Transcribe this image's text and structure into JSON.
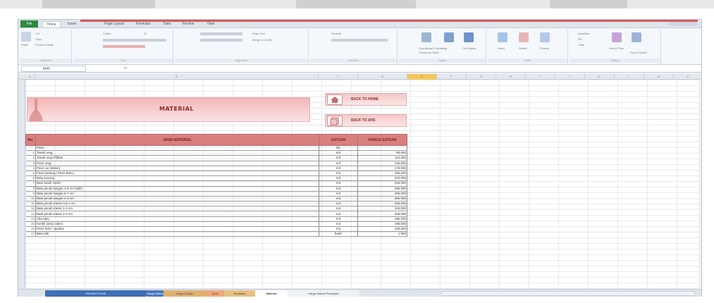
{
  "ribbon": {
    "file_tab": "File",
    "tabs": [
      "Home",
      "Insert",
      "Page Layout",
      "Formulas",
      "Data",
      "Review",
      "View"
    ],
    "clipboard": {
      "paste": "Paste",
      "cut": "Cut",
      "copy": "Copy",
      "format_painter": "Format Painter",
      "group": "Clipboard"
    },
    "font": {
      "name": "Calibri",
      "size": "11",
      "group": "Font"
    },
    "alignment": {
      "wrap": "Wrap Text",
      "merge": "Merge & Center",
      "group": "Alignment"
    },
    "number": {
      "format": "General",
      "group": "Number"
    },
    "styles": {
      "conditional": "Conditional Formatting",
      "format_table": "Format as Table",
      "cell_styles": "Cell Styles",
      "group": "Styles"
    },
    "cells": {
      "insert": "Insert",
      "delete": "Delete",
      "format": "Format",
      "group": "Cells"
    },
    "editing": {
      "autosum": "AutoSum",
      "fill": "Fill",
      "clear": "Clear",
      "sort": "Sort & Filter",
      "find": "Find & Select",
      "group": "Editing"
    }
  },
  "formula_bar": {
    "name_box": "M40",
    "fx": "fx"
  },
  "colors": {
    "accent_red": "#d35e5e",
    "header_fill": "#d88080",
    "banner_fill": "#f3b6b6",
    "selected_col": "#f3c65b"
  },
  "material": {
    "title": "MATERIAL"
  },
  "nav": {
    "back_home": "BACK TO HOME",
    "back_ahs": "BACK TO AHS",
    "home_icon": "home-icon",
    "ahs_icon": "document-icon"
  },
  "table": {
    "headers": {
      "no": "No.",
      "jenis": "JENIS MATERIAL",
      "satuan": "SATUAN",
      "harga": "HARGA SATUAN"
    },
    "rows": [
      {
        "no": "",
        "jenis": "Pasir",
        "satuan": "Rp",
        "harga": ""
      },
      {
        "no": "1",
        "jenis": "Tanah urug",
        "satuan": "m3",
        "harga": "85.000"
      },
      {
        "no": "2",
        "jenis": "Tanah urug Pilihan",
        "satuan": "m3",
        "harga": "112.000"
      },
      {
        "no": "3",
        "jenis": "Pasir urug",
        "satuan": "m3",
        "harga": "125.000"
      },
      {
        "no": "4",
        "jenis": "Pasir cor (beton)",
        "satuan": "m3",
        "harga": "175.000"
      },
      {
        "no": "5",
        "jenis": "Pasir pasang / Pasir Batco",
        "satuan": "m3",
        "harga": "165.000"
      },
      {
        "no": "6",
        "jenis": "Batu kosong",
        "satuan": "m3",
        "harga": "210.000"
      },
      {
        "no": "7",
        "jenis": "Batu belah 15/20",
        "satuan": "m3",
        "harga": "225.000"
      },
      {
        "no": "8",
        "jenis": "Batu pecah tangan 3-5 cm (split)",
        "satuan": "m3",
        "harga": "285.000"
      },
      {
        "no": "9",
        "jenis": "Batu pecah tangan 5-7 cm",
        "satuan": "m3",
        "harga": "265.000"
      },
      {
        "no": "10",
        "jenis": "Batu pecah tangan 2-3 cm",
        "satuan": "m3",
        "harga": "295.000"
      },
      {
        "no": "11",
        "jenis": "Batu pecah mesin 0,5-1 cm",
        "satuan": "m3",
        "harga": "325.000"
      },
      {
        "no": "12",
        "jenis": "Batu pecah mesin 1-2 cm",
        "satuan": "m3",
        "harga": "315.000"
      },
      {
        "no": "13",
        "jenis": "Batu pecah mesin 2-3 cm",
        "satuan": "m3",
        "harga": "305.000"
      },
      {
        "no": "14",
        "jenis": "Abu batu",
        "satuan": "m3",
        "harga": "185.000"
      },
      {
        "no": "15",
        "jenis": "Kerikil (sirtu) alami",
        "satuan": "m3",
        "harga": "195.000"
      },
      {
        "no": "16",
        "jenis": "Pasir Sirtu / ayakan",
        "satuan": "m3",
        "harga": "155.000"
      },
      {
        "no": "17",
        "jenis": "Batu kali",
        "satuan": "buah",
        "harga": "1.500"
      }
    ]
  },
  "sheet_tabs": [
    "REKAPITULASI",
    "Harga Satuan",
    "Upah",
    "Peralatan",
    "Material",
    "Harga Satuan Pekerjaan"
  ],
  "active_sheet": "Material"
}
